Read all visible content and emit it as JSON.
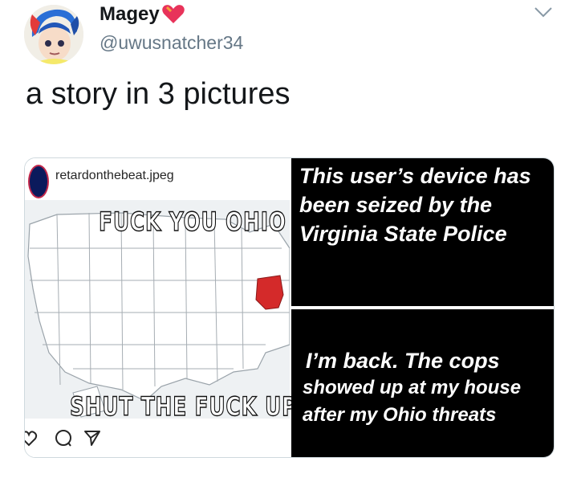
{
  "tweet": {
    "display_name": "Magey",
    "handle": "@uwusnatcher34",
    "text": "a story in 3 pictures"
  },
  "media": {
    "instagram_post": {
      "username": "retardonthebeat.jpeg",
      "meme_top": "FUCK YOU OHIO",
      "meme_bottom": "SHUT THE FUCK UP",
      "highlight_color": "#d42a2a"
    },
    "story_1": {
      "text": "This user’s device has been seized by the Virginia State Police"
    },
    "story_2": {
      "line1": "I’m back. The cops",
      "line2": "showed up at my house",
      "line3": "after my Ohio threats"
    }
  }
}
